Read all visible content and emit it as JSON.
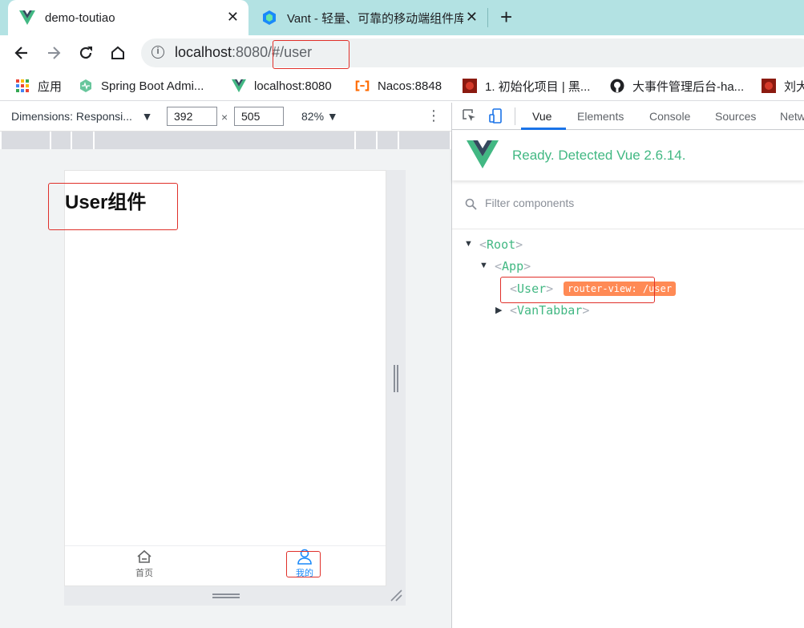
{
  "browser": {
    "tabs": [
      {
        "title": "demo-toutiao",
        "active": true
      },
      {
        "title": "Vant - 轻量、可靠的移动端组件库",
        "active": false
      }
    ],
    "new_tab": "+",
    "close_glyph": "✕",
    "url": {
      "host": "localhost",
      "port": ":8080/",
      "path": "#/user"
    },
    "bookmarks": [
      {
        "label": "应用",
        "icon": "apps-grid-icon"
      },
      {
        "label": "Spring Boot Admi...",
        "icon": "spring-boot-admin-icon"
      },
      {
        "label": "localhost:8080",
        "icon": "vue-logo-icon"
      },
      {
        "label": "Nacos:8848",
        "icon": "nacos-icon"
      },
      {
        "label": "1. 初始化项目 | 黑...",
        "icon": "heima-icon"
      },
      {
        "label": "大事件管理后台-ha...",
        "icon": "github-icon"
      },
      {
        "label": "刘大",
        "icon": "heima-icon"
      }
    ]
  },
  "device_toolbar": {
    "dimensions_label": "Dimensions: Responsi...",
    "dropdown_arrow": "▼",
    "width": "392",
    "height": "505",
    "times": "×",
    "zoom": "82% ▼",
    "more": "⋮"
  },
  "app": {
    "title": "User组件",
    "tabbar": [
      {
        "label": "首页",
        "icon": "home-icon",
        "active": false
      },
      {
        "label": "我的",
        "icon": "user-icon",
        "active": true
      }
    ],
    "colors": {
      "tab_active": "#1989fa",
      "tab_inactive": "#646566"
    }
  },
  "devtools": {
    "tabs": [
      "Vue",
      "Elements",
      "Console",
      "Sources",
      "Netw"
    ],
    "active_tab": "Vue",
    "ready_message": "Ready. Detected Vue 2.6.14.",
    "filter_placeholder": "Filter components",
    "tree": [
      {
        "name": "Root",
        "expanded": true
      },
      {
        "name": "App",
        "expanded": true
      },
      {
        "name": "User",
        "badge": "router-view: /user"
      },
      {
        "name": "VanTabbar",
        "expanded": false
      }
    ],
    "colors": {
      "vue_green": "#42b883",
      "badge": "#ff8a55",
      "accent": "#1a73e8"
    }
  }
}
